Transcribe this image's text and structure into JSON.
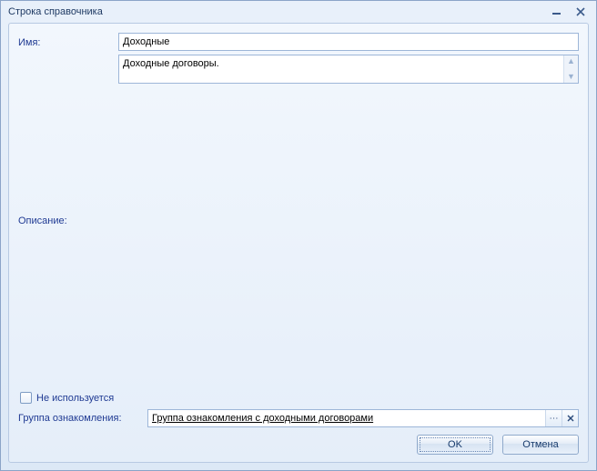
{
  "window": {
    "title": "Строка справочника"
  },
  "form": {
    "name_label": "Имя:",
    "name_value": "Доходные",
    "description_label": "Описание:",
    "description_value": "Доходные договоры.",
    "not_used_label": "Не используется",
    "not_used_checked": false,
    "group_label": "Группа ознакомления:",
    "group_value": "Группа ознакомления с доходными договорами"
  },
  "buttons": {
    "ok": "OK",
    "cancel": "Отмена"
  }
}
